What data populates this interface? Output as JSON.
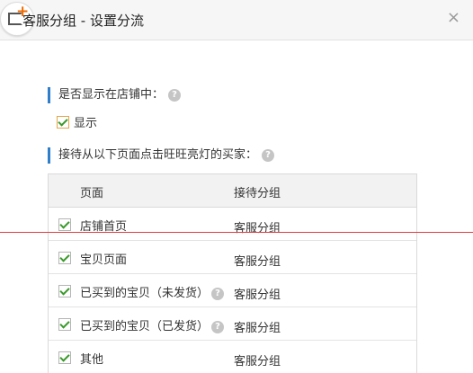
{
  "dialog": {
    "title": "客服分组 - 设置分流",
    "close_glyph": "×"
  },
  "section1": {
    "label": "是否显示在店铺中：",
    "help_glyph": "?",
    "show_checkbox": {
      "checked": true,
      "label": "显示"
    }
  },
  "section2": {
    "label": "接待从以下页面点击旺旺亮灯的买家：",
    "help_glyph": "?"
  },
  "table": {
    "headers": {
      "page": "页面",
      "group": "接待分组"
    },
    "rows": [
      {
        "checked": true,
        "page": "店铺首页",
        "group": "客服分组",
        "help": false
      },
      {
        "checked": true,
        "page": "宝贝页面",
        "group": "客服分组",
        "help": false
      },
      {
        "checked": true,
        "page": "已买到的宝贝（未发货）",
        "group": "客服分组",
        "help": true
      },
      {
        "checked": true,
        "page": "已买到的宝贝（已发货）",
        "group": "客服分组",
        "help": true
      },
      {
        "checked": true,
        "page": "其他",
        "group": "客服分组",
        "help": false
      }
    ]
  },
  "colors": {
    "accent_bar": "#2f7ec9",
    "checkmark": "#3a9a2a",
    "icon_plus": "#f06a00",
    "red_line": "#e04040"
  }
}
